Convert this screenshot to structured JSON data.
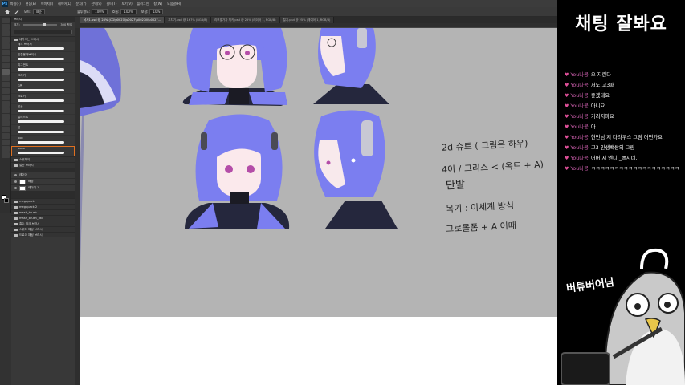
{
  "photoshop": {
    "logo": "Ps",
    "menu": [
      "파일(F)",
      "편집(E)",
      "이미지(I)",
      "레이어(L)",
      "문자(Y)",
      "선택(S)",
      "필터(T)",
      "보기(V)",
      "플러그인",
      "창(W)",
      "도움말(H)"
    ],
    "options": {
      "mode_label": "모드:",
      "mode_value": "표준",
      "opacity_label": "불투명도:",
      "opacity_value": "100%",
      "flow_label": "흐름:",
      "flow_value": "100%",
      "smoothing_label": "보정:",
      "smoothing_value": "10%"
    },
    "doc_tabs": [
      "낙서1.psd @ 28% (CG\\u0027l\\u0027\\u0027ill\\u0027...",
      "고치기.psd @ 167% (RGB/8)",
      "리모델가자 지키.psd @ 25% (레이어 1, RGB/8)",
      "털기.psd @ 25% (레이어 1, RGB/8)"
    ],
    "brushes_panel": {
      "header": "브러시",
      "size_label": "크기:",
      "size_value": "300 픽셀",
      "folder_name": "내가쓰는 브러시",
      "brushes": [
        "테크 브러시",
        "밑칠용애브러시",
        "피그먼트",
        "그리기",
        "G펜",
        "크로키",
        "골곤",
        "일러스트",
        "선",
        "ooo",
        "oooo"
      ],
      "folder2_name": "스위체이",
      "folder3_name": "일반 브러시"
    },
    "layers_panel": {
      "items": [
        "레이어",
        "배경",
        "레이어 1",
        "megapack",
        "megapack 2",
        "mash_brush",
        "mash_brush_list",
        "흑수 퀄크 브러시",
        "스위터 채팅 브러시",
        "드로이 채팅 브러시"
      ]
    }
  },
  "canvas": {
    "notes": [
      "2d 슈트 ( 그림은 하우)",
      "4이 / 그리스 < (옥트 + A)",
      "단발",
      "목기 : 이세계 방식",
      "그로몰폼 + A 어때"
    ]
  },
  "chat": {
    "title": "채팅 잘봐요",
    "messages": [
      {
        "nick": "You나몽",
        "text": "오 지린다"
      },
      {
        "nick": "You나몽",
        "text": "저도 고3때"
      },
      {
        "nick": "You나몽",
        "text": "좋겠대요"
      },
      {
        "nick": "You나몽",
        "text": "아니요"
      },
      {
        "nick": "You나몽",
        "text": "가리지마요"
      },
      {
        "nick": "You나몽",
        "text": "아"
      },
      {
        "nick": "You나몽",
        "text": "현빈님 저 다라우스 그림 어떤가요"
      },
      {
        "nick": "You나몽",
        "text": "고3 인생백쌍의 그림"
      },
      {
        "nick": "You나몽",
        "text": "어머 저 엔니 _쁘시네."
      },
      {
        "nick": "You나몽",
        "text": "ㅋㅋㅋㅋㅋㅋㅋㅋㅋㅋㅋㅋㅋㅋㅋㅋㅋㅋㅋ"
      }
    ],
    "mascot_label": "버튜버어님"
  },
  "colors": {
    "chat_bg": "#000000",
    "nick": "#d060b0",
    "heart": "#e0509a",
    "canvas_gray": "#b4b4b4",
    "hair": "#7b7ef0"
  }
}
